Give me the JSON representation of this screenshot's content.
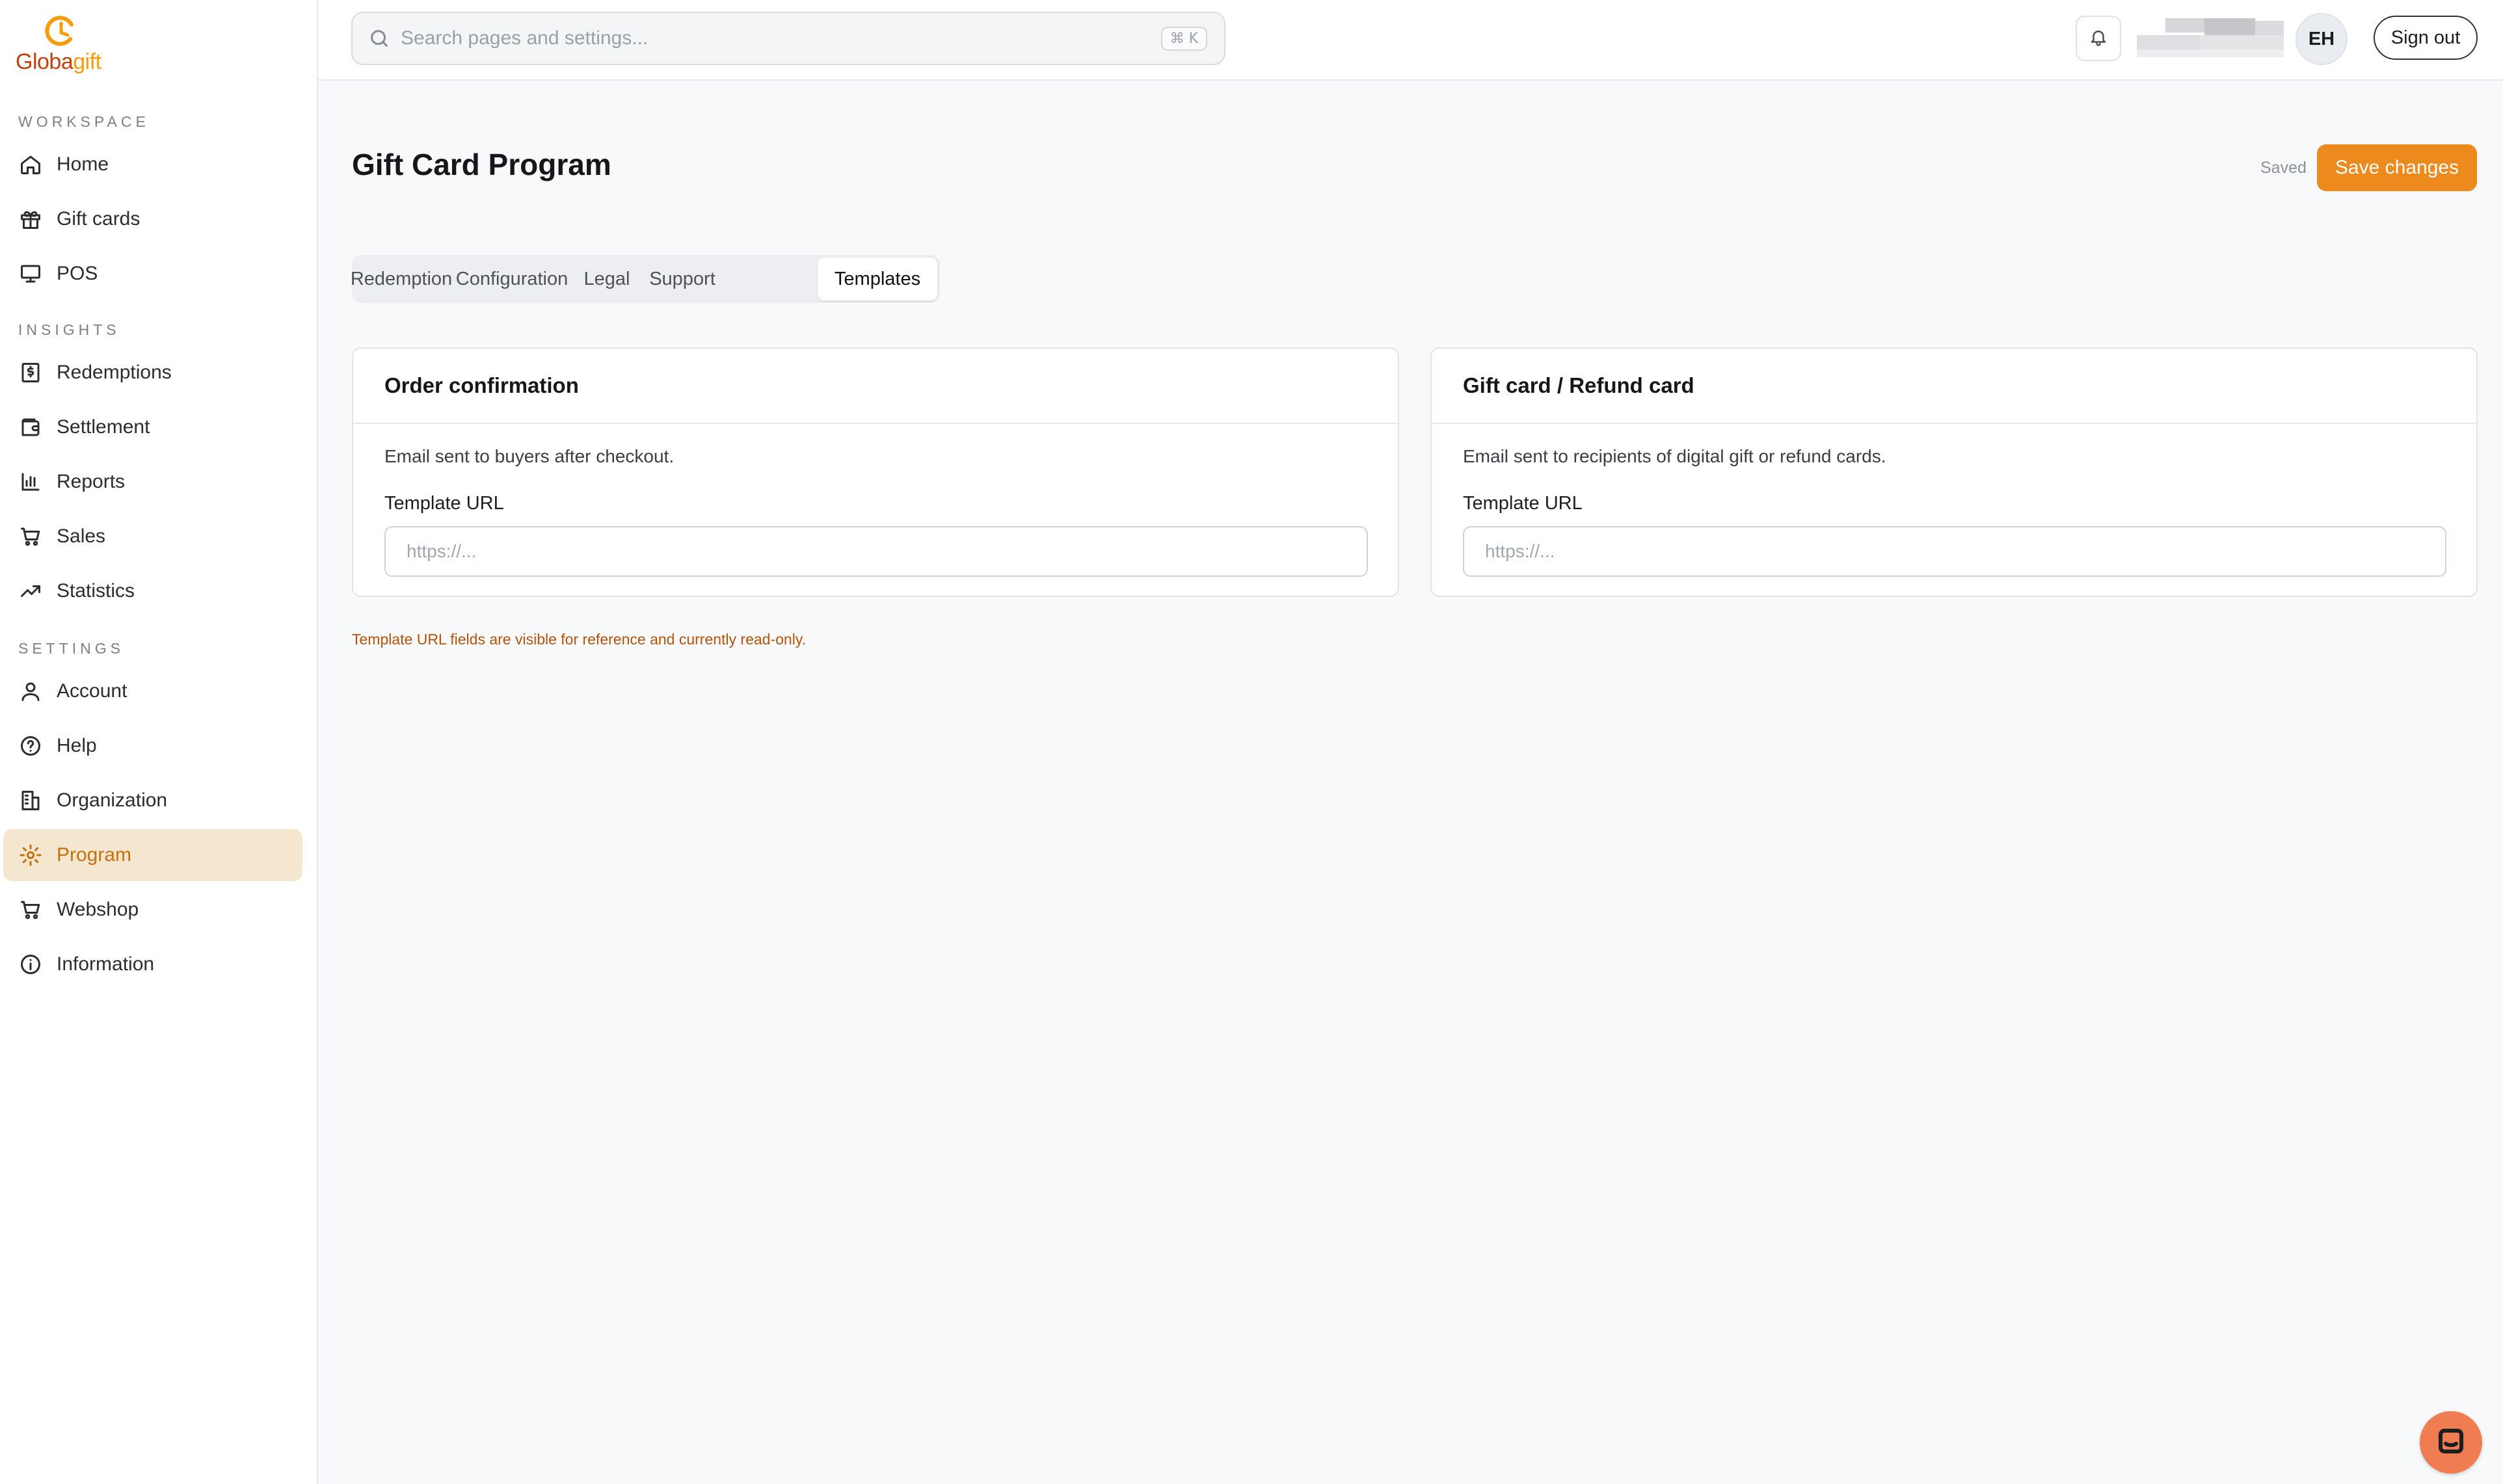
{
  "brand": {
    "name_part1": "Globa",
    "name_part2": "gift",
    "accent": "#ec8a1d"
  },
  "sidebar": {
    "sections": [
      {
        "label": "WORKSPACE",
        "items": [
          {
            "label": "Home",
            "icon": "home-icon"
          },
          {
            "label": "Gift cards",
            "icon": "gift-icon"
          },
          {
            "label": "POS",
            "icon": "monitor-icon"
          }
        ]
      },
      {
        "label": "INSIGHTS",
        "items": [
          {
            "label": "Redemptions",
            "icon": "receipt-icon"
          },
          {
            "label": "Settlement",
            "icon": "wallet-icon"
          },
          {
            "label": "Reports",
            "icon": "bar-chart-icon"
          },
          {
            "label": "Sales",
            "icon": "cart-icon"
          },
          {
            "label": "Statistics",
            "icon": "trending-up-icon"
          }
        ]
      },
      {
        "label": "SETTINGS",
        "items": [
          {
            "label": "Account",
            "icon": "user-icon"
          },
          {
            "label": "Help",
            "icon": "help-circle-icon"
          },
          {
            "label": "Organization",
            "icon": "building-icon"
          },
          {
            "label": "Program",
            "icon": "gear-icon",
            "active": true
          },
          {
            "label": "Webshop",
            "icon": "cart-icon"
          },
          {
            "label": "Information",
            "icon": "info-icon"
          }
        ]
      }
    ]
  },
  "header": {
    "search_placeholder": "Search pages and settings...",
    "search_shortcut": "⌘ K",
    "avatar_initials": "EH",
    "signout_label": "Sign out"
  },
  "main": {
    "title": "Gift Card Program",
    "saved_status": "Saved",
    "save_label": "Save changes",
    "tabs": [
      {
        "label": "Redemption"
      },
      {
        "label": "Configuration"
      },
      {
        "label": "Legal"
      },
      {
        "label": "Support"
      },
      {
        "label": "Templates",
        "active": true
      }
    ],
    "cards": [
      {
        "title": "Order confirmation",
        "description": "Email sent to buyers after checkout.",
        "field_label": "Template URL",
        "placeholder": "https://..."
      },
      {
        "title": "Gift card / Refund card",
        "description": "Email sent to recipients of digital gift or refund cards.",
        "field_label": "Template URL",
        "placeholder": "https://..."
      }
    ],
    "note": "Template URL fields are visible for reference and currently read-only."
  }
}
